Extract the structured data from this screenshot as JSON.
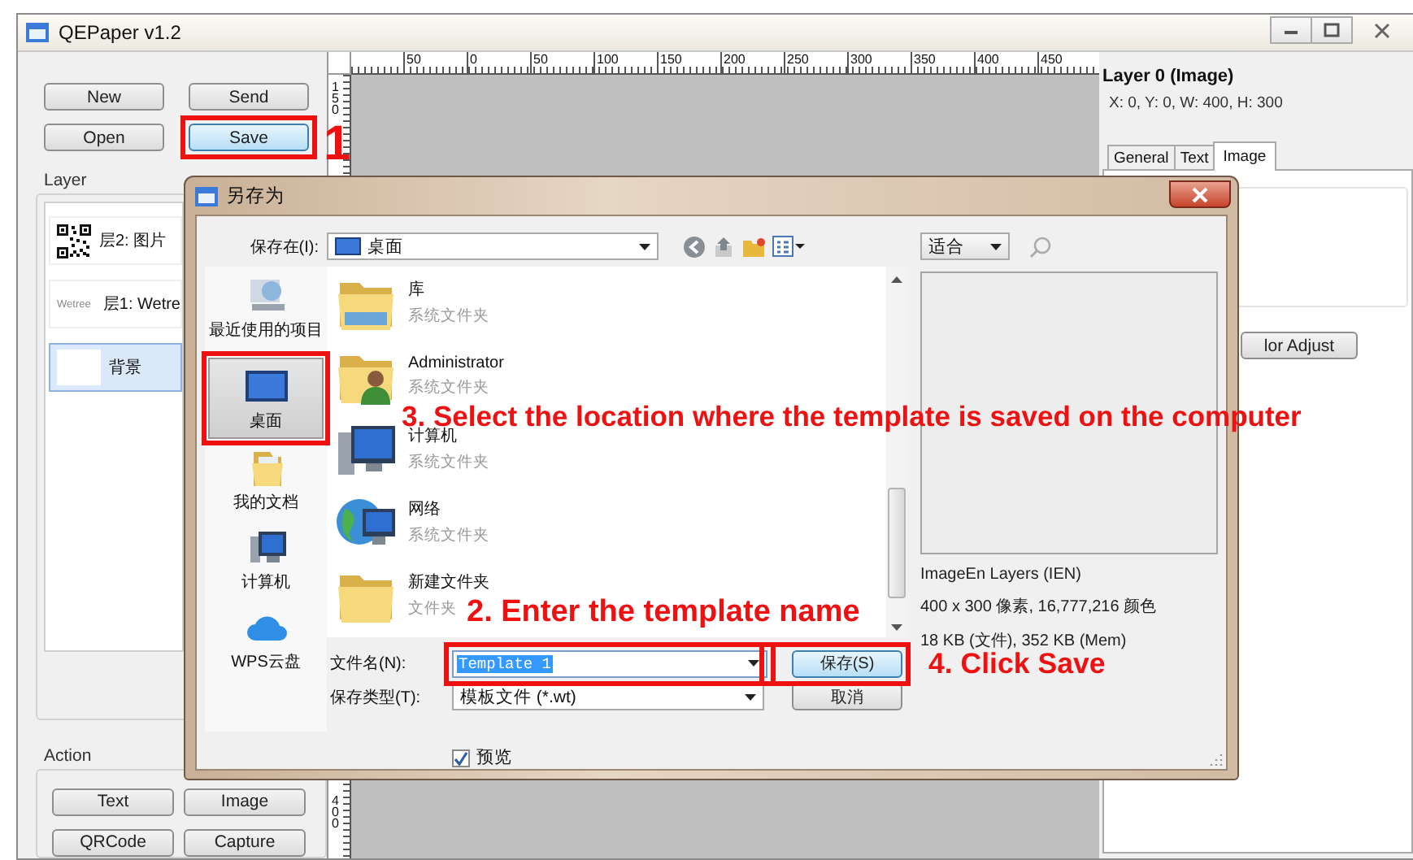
{
  "window": {
    "title": "QEPaper v1.2"
  },
  "toolbar_buttons": [
    {
      "label": "New",
      "highlighted": false,
      "marked": false
    },
    {
      "label": "Send",
      "highlighted": false,
      "marked": false
    },
    {
      "label": "Open",
      "highlighted": false,
      "marked": false
    },
    {
      "label": "Save",
      "highlighted": true,
      "marked": true
    }
  ],
  "layer_group": {
    "title": "Layer",
    "items": [
      {
        "kind": "qrcode",
        "label": "层2: 图片",
        "selected": false
      },
      {
        "kind": "text",
        "thumb_text": "Wetree",
        "label": "层1: Wetre",
        "selected": false
      },
      {
        "kind": "blank",
        "label": "背景",
        "selected": true
      }
    ]
  },
  "action_group": {
    "title": "Action",
    "buttons": [
      "Text",
      "Image",
      "QRCode",
      "Capture"
    ]
  },
  "canvas": {
    "top_ruler": [
      "50",
      "0",
      "50",
      "100",
      "150",
      "200",
      "250",
      "300",
      "350",
      "400",
      "450"
    ],
    "left_ruler": [
      "150",
      "400"
    ]
  },
  "properties": {
    "title": "Layer 0 (Image)",
    "geometry": "X: 0, Y: 0, W: 400, H: 300",
    "tabs": [
      {
        "label": "General",
        "selected": false
      },
      {
        "label": "Text",
        "selected": false
      },
      {
        "label": "Image",
        "selected": true
      }
    ],
    "button": "lor Adjust"
  },
  "dialog": {
    "title": "另存为",
    "location_label": "保存在(I):",
    "location": "桌面",
    "view_mode": "适合",
    "places": [
      {
        "kind": "recent",
        "label": "最近使用的项目",
        "selected": false,
        "marked": false
      },
      {
        "kind": "desktop",
        "label": "桌面",
        "selected": true,
        "marked": true
      },
      {
        "kind": "documents",
        "label": "我的文档",
        "selected": false,
        "marked": false
      },
      {
        "kind": "computer",
        "label": "计算机",
        "selected": false,
        "marked": false
      },
      {
        "kind": "cloud",
        "label": "WPS云盘",
        "selected": false,
        "marked": false
      }
    ],
    "files": [
      {
        "kind": "library",
        "name": "库",
        "type": "系统文件夹"
      },
      {
        "kind": "user",
        "name": "Administrator",
        "type": "系统文件夹"
      },
      {
        "kind": "computer",
        "name": "计算机",
        "type": "系统文件夹"
      },
      {
        "kind": "network",
        "name": "网络",
        "type": "系统文件夹"
      },
      {
        "kind": "folder",
        "name": "新建文件夹",
        "type": "文件夹"
      }
    ],
    "preview_info": [
      "ImageEn Layers (IEN)",
      "400 x 300 像素, 16,777,216 颜色",
      "18 KB (文件), 352 KB (Mem)"
    ],
    "filename_label": "文件名(N):",
    "filename": {
      "value": "Template 1",
      "text_selected": true,
      "marked": true
    },
    "filetype_label": "保存类型(T):",
    "filetype": "模板文件 (*.wt)",
    "save_button": {
      "label": "保存(S)",
      "default": true,
      "marked": true
    },
    "cancel_button": {
      "label": "取消"
    },
    "preview": {
      "label": "预览",
      "checked": true
    }
  },
  "callouts": [
    {
      "text": "1"
    },
    {
      "text": "3. Select the location where the template is saved on the computer"
    },
    {
      "text": "2. Enter the template name"
    },
    {
      "text": "4. Click Save"
    }
  ]
}
